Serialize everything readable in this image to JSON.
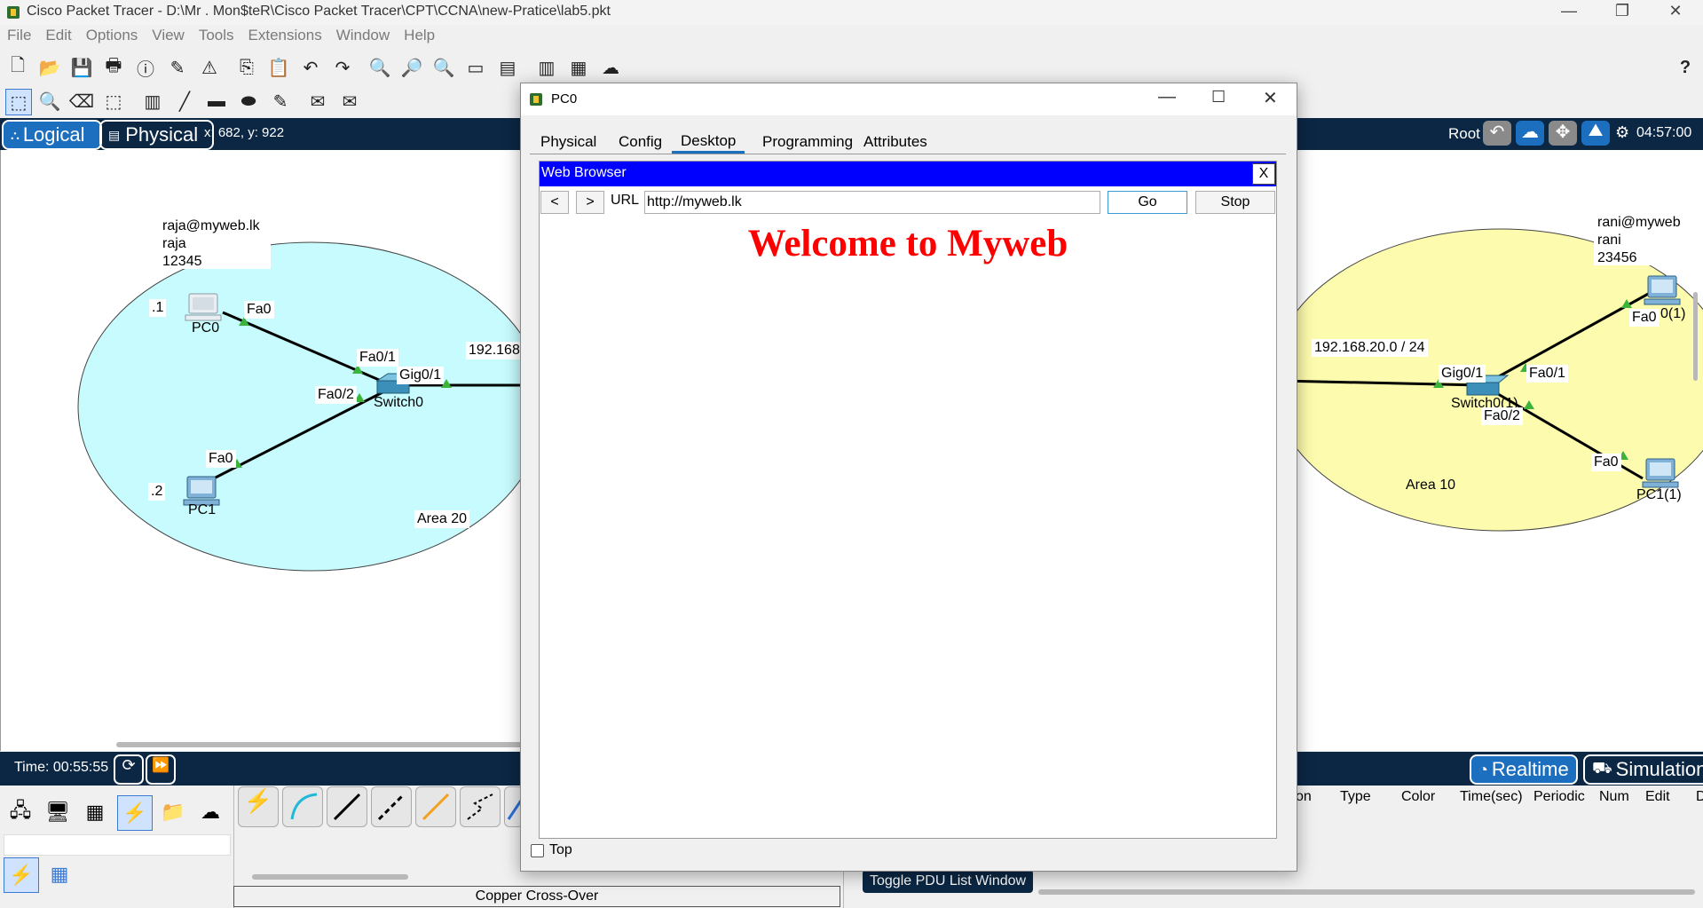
{
  "app": {
    "title": "Cisco Packet Tracer - D:\\Mr . Mon$teR\\Cisco Packet Tracer\\CPT\\CCNA\\new-Pratice\\lab5.pkt",
    "window_controls": {
      "minimize": "—",
      "restore": "❐",
      "close": "✕"
    }
  },
  "menu": [
    "File",
    "Edit",
    "Options",
    "View",
    "Tools",
    "Extensions",
    "Window",
    "Help"
  ],
  "help_icon": "?",
  "logical_bar": {
    "logical_label": "Logical",
    "physical_label": "Physical",
    "coords": "x: 682, y: 922",
    "root_label": "Root",
    "clock": "04:57:00"
  },
  "workspace": {
    "left_area": {
      "note_lines": [
        "raja@myweb.lk",
        "raja",
        "12345"
      ],
      "pc0_label": "PC0",
      "pc0_addr": ".1",
      "pc0_port": "Fa0",
      "pc1_label": "PC1",
      "pc1_addr": ".2",
      "pc1_port": "Fa0",
      "switch_label": "Switch0",
      "switch_fa01": "Fa0/1",
      "switch_fa02": "Fa0/2",
      "switch_gig": "Gig0/1",
      "network": "192.168",
      "area_label": "Area 20"
    },
    "right_area": {
      "note_lines": [
        "rani@myweb",
        "rani",
        "23456"
      ],
      "network": "192.168.20.0 / 24",
      "switch_gig": "Gig0/1",
      "switch_fa01": "Fa0/1",
      "switch_fa02": "Fa0/2",
      "switch_label": "Switch0(1)",
      "pc_top_port": "Fa0",
      "pc_top_label": "0(1)",
      "pc_bottom_port": "Fa0",
      "pc_bottom_label": "PC1(1)",
      "area_label": "Area 10"
    },
    "colors": {
      "left_area": "#c7fbfd",
      "right_area": "#fdfbad",
      "link_marker": "#3cb43c"
    }
  },
  "time_bar": {
    "time_label": "Time: 00:55:55",
    "realtime_label": "Realtime",
    "simulation_label": "Simulation"
  },
  "bottom": {
    "cable_name": "Copper Cross-Over",
    "toggle_pdu": "Toggle PDU List Window",
    "pdu_columns": [
      "on",
      "Type",
      "Color",
      "Time(sec)",
      "Periodic",
      "Num",
      "Edit",
      "Delete"
    ]
  },
  "dialog": {
    "title": "PC0",
    "tabs": [
      "Physical",
      "Config",
      "Desktop",
      "Programming",
      "Attributes"
    ],
    "active_tab": "Desktop",
    "browser": {
      "title": "Web Browser",
      "close": "X",
      "back": "<",
      "forward": ">",
      "url_label": "URL",
      "url": "http://myweb.lk",
      "go": "Go",
      "stop": "Stop",
      "heading": "Welcome to Myweb",
      "heading_color": "#ff0000",
      "header_color": "#0000ff"
    },
    "top_checkbox_label": "Top",
    "top_checked": false
  }
}
